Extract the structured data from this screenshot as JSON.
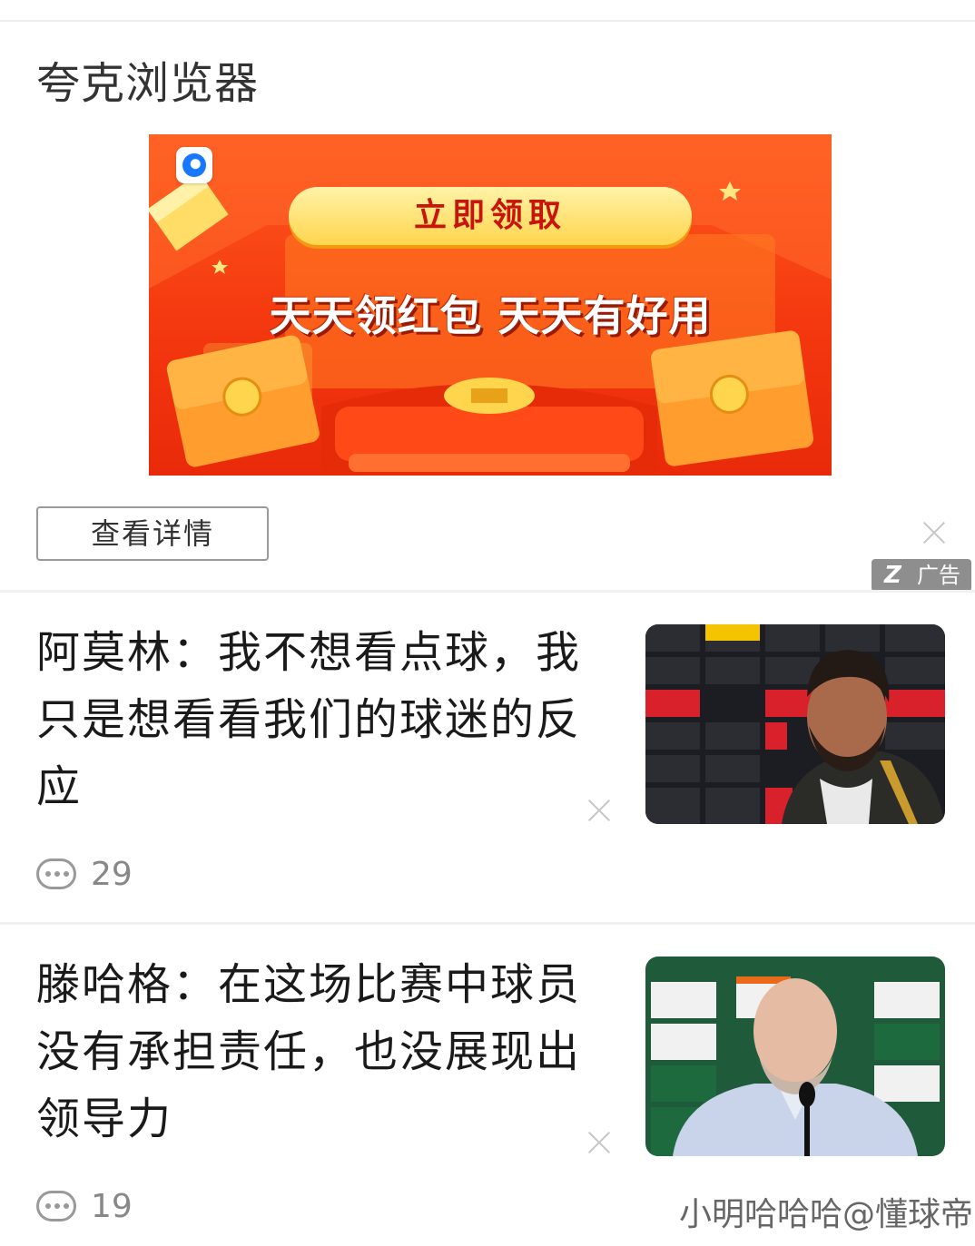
{
  "ad": {
    "source": "夸克浏览器",
    "banner": {
      "button_text": "立即领取",
      "slogan": "天天领红包  天天有好用"
    },
    "details_button": "查看详情",
    "badge_text": "广告"
  },
  "feed": [
    {
      "title": "阿莫林：我不想看点球，我只是想看看我们的球迷的反应",
      "comments": "29"
    },
    {
      "title": "滕哈格：在这场比赛中球员没有承担责任，也没展现出领导力",
      "comments": "19"
    }
  ],
  "watermark": "小明哈哈哈@懂球帝",
  "colors": {
    "banner_red": "#f4380f",
    "banner_gold": "#ffd54d",
    "button_text_red": "#c7140c",
    "badge_gray": "#8e8e8e"
  },
  "icons": [
    "quark-logo-icon",
    "close-icon",
    "ad-mark-icon",
    "comment-icon"
  ]
}
